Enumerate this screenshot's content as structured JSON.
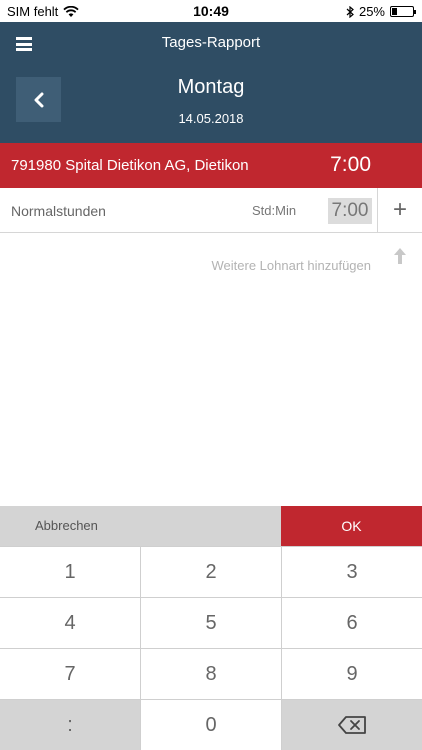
{
  "status_bar": {
    "carrier": "SIM fehlt",
    "time": "10:49",
    "battery_text": "25%",
    "battery_level": 0.25
  },
  "header": {
    "app_title": "Tages-Rapport",
    "day": "Montag",
    "date": "14.05.2018"
  },
  "project": {
    "name": "791980 Spital Dietikon AG, Dietikon",
    "hours": "7:00"
  },
  "entry": {
    "label": "Normalstunden",
    "unit": "Std:Min",
    "value": "7:00",
    "plus": "+"
  },
  "add_wage_type": "Weitere Lohnart hinzufügen",
  "actions": {
    "cancel": "Abbrechen",
    "ok": "OK"
  },
  "keypad": {
    "k1": "1",
    "k2": "2",
    "k3": "3",
    "k4": "4",
    "k5": "5",
    "k6": "6",
    "k7": "7",
    "k8": "8",
    "k9": "9",
    "colon": ":",
    "k0": "0"
  },
  "colors": {
    "header_bg": "#2f4d64",
    "accent_red": "#c0272f"
  }
}
